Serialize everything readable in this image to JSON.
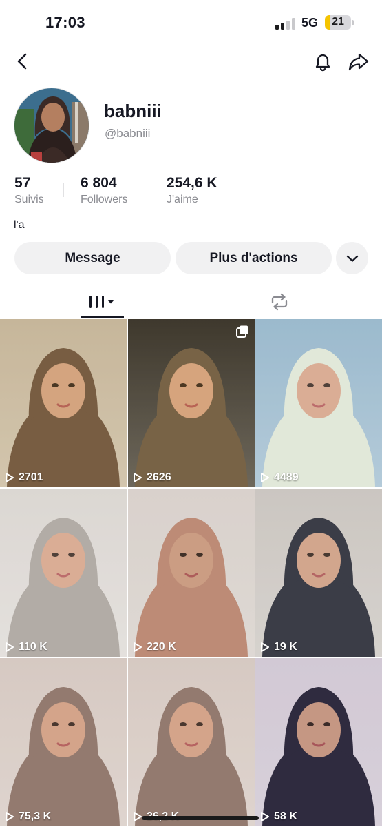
{
  "status_bar": {
    "time": "17:03",
    "network": "5G",
    "battery_level": "21",
    "battery_fraction": 0.21,
    "signal_bars_active": 2
  },
  "nav": {
    "back_icon": "chevron-left-icon",
    "bell_icon": "bell-icon",
    "share_icon": "share-arrow-icon"
  },
  "profile": {
    "display_name": "babniii",
    "handle": "@babniii",
    "bio": "l'a"
  },
  "stats": [
    {
      "value": "57",
      "label": "Suivis"
    },
    {
      "value": "6 804",
      "label": "Followers"
    },
    {
      "value": "254,6 K",
      "label": "J'aime"
    }
  ],
  "actions": {
    "message": "Message",
    "more_actions": "Plus d'actions",
    "dropdown_icon": "chevron-down-icon"
  },
  "tabs": [
    {
      "icon": "video-grid-icon",
      "active": true
    },
    {
      "icon": "repost-icon",
      "active": false
    }
  ],
  "grid": [
    {
      "views": "2701",
      "colors": [
        "#c7b9a8",
        "#6e5444",
        "#c9a43a"
      ],
      "multi": false
    },
    {
      "views": "2626",
      "colors": [
        "#2a2a2e",
        "#6b5b4a",
        "#d4a62a"
      ],
      "multi": true
    },
    {
      "views": "4489",
      "colors": [
        "#8fb3c9",
        "#dfe8d6",
        "#f3f1ec"
      ],
      "multi": false
    },
    {
      "views": "110 K",
      "colors": [
        "#d8d4cf",
        "#a9a39c",
        "#f4f2f0"
      ],
      "multi": false
    },
    {
      "views": "220 K",
      "colors": [
        "#e6e0dc",
        "#c7907a",
        "#7a6a5e"
      ],
      "multi": false
    },
    {
      "views": "19 K",
      "colors": [
        "#cfc9c4",
        "#2b2d3a",
        "#b8b2ac"
      ],
      "multi": false
    },
    {
      "views": "75,3 K",
      "colors": [
        "#d9cfc9",
        "#8c756a",
        "#c2a897"
      ],
      "multi": false
    },
    {
      "views": "26,2 K",
      "colors": [
        "#d9cfc9",
        "#8c756a",
        "#c2a897"
      ],
      "multi": false
    },
    {
      "views": "58 K",
      "colors": [
        "#e5dde6",
        "#2c2a3c",
        "#4a3c5c"
      ],
      "multi": false
    }
  ]
}
